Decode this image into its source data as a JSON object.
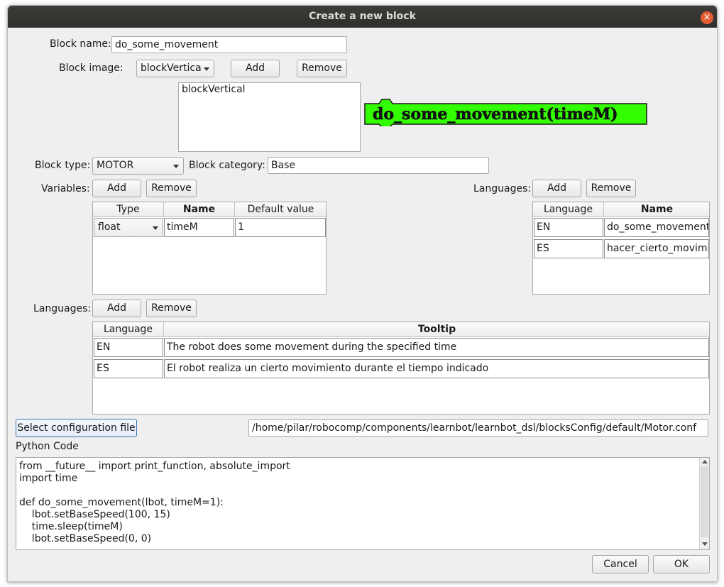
{
  "window": {
    "title": "Create a new block",
    "close_icon": "×"
  },
  "block_name": {
    "label": "Block name:",
    "value": "do_some_movement"
  },
  "block_image": {
    "label": "Block image:",
    "selected": "blockVertica",
    "add_label": "Add",
    "remove_label": "Remove",
    "list_items": [
      "blockVertical"
    ],
    "preview_text": "do_some_movement(timeM)",
    "preview_color": "#33ff00"
  },
  "block_type": {
    "label": "Block type:",
    "selected": "MOTOR"
  },
  "block_category": {
    "label": "Block category:",
    "value": "Base"
  },
  "variables": {
    "label": "Variables:",
    "add_label": "Add",
    "remove_label": "Remove",
    "headers": [
      "Type",
      "Name",
      "Default value"
    ],
    "rows": [
      {
        "type": "float",
        "name": "timeM",
        "default": "1"
      }
    ]
  },
  "name_languages": {
    "label": "Languages:",
    "add_label": "Add",
    "remove_label": "Remove",
    "headers": [
      "Language",
      "Name"
    ],
    "rows": [
      {
        "language": "EN",
        "name": "do_some_movement"
      },
      {
        "language": "ES",
        "name": "hacer_cierto_movimie"
      }
    ]
  },
  "tooltip_languages": {
    "label": "Languages:",
    "add_label": "Add",
    "remove_label": "Remove",
    "headers": [
      "Language",
      "Tooltip"
    ],
    "rows": [
      {
        "language": "EN",
        "tooltip": "The robot does some movement during the specified time"
      },
      {
        "language": "ES",
        "tooltip": "El robot realiza un cierto movimiento durante el tiempo indicado"
      }
    ]
  },
  "config": {
    "button_label": "Select configuration file",
    "path": "/home/pilar/robocomp/components/learnbot/learnbot_dsl/blocksConfig/default/Motor.conf"
  },
  "python": {
    "label": "Python Code",
    "code": "from __future__ import print_function, absolute_import\nimport time\n\ndef do_some_movement(lbot, timeM=1):\n    lbot.setBaseSpeed(100, 15)\n    time.sleep(timeM)\n    lbot.setBaseSpeed(0, 0)"
  },
  "footer": {
    "cancel_label": "Cancel",
    "ok_label": "OK"
  }
}
